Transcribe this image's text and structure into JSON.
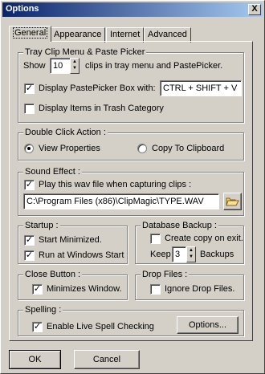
{
  "window": {
    "title": "Options",
    "close_symbol": "X"
  },
  "tabs": [
    {
      "label": "General",
      "active": true
    },
    {
      "label": "Appearance",
      "active": false
    },
    {
      "label": "Internet",
      "active": false
    },
    {
      "label": "Advanced",
      "active": false
    }
  ],
  "tray": {
    "group_label": "Tray Clip Menu & Paste Picker",
    "show_label": "Show",
    "show_count": "10",
    "show_suffix": "clips in tray menu and PastePicker.",
    "display_picker_label": "Display PastePicker Box",
    "display_picker_checked": true,
    "with_label": "with:",
    "hotkey": "CTRL + SHIFT + V",
    "display_trash_label": "Display Items in Trash Category",
    "display_trash_checked": false
  },
  "double_click": {
    "group_label": "Double Click Action :",
    "option_view": "View Properties",
    "option_copy": "Copy To Clipboard",
    "selected": "view"
  },
  "sound": {
    "group_label": "Sound Effect :",
    "play_label": "Play this wav file when capturing clips :",
    "play_checked": true,
    "path": "C:\\Program Files (x86)\\ClipMagic\\TYPE.WAV",
    "browse_icon": "folder-open-icon"
  },
  "startup": {
    "group_label": "Startup :",
    "minimized_label": "Start Minimized.",
    "minimized_checked": true,
    "run_label": "Run at Windows Start",
    "run_checked": true
  },
  "backup": {
    "group_label": "Database Backup :",
    "create_label": "Create copy on exit.",
    "create_checked": false,
    "keep_label": "Keep",
    "keep_value": "3",
    "backups_label": "Backups"
  },
  "close_button": {
    "group_label": "Close Button :",
    "minimizes_label": "Minimizes Window.",
    "minimizes_checked": true
  },
  "drop_files": {
    "group_label": "Drop Files :",
    "ignore_label": "Ignore Drop Files.",
    "ignore_checked": false
  },
  "spelling": {
    "group_label": "Spelling :",
    "live_label": "Enable Live Spell Checking",
    "live_checked": true,
    "options_button": "Options..."
  },
  "footer": {
    "ok": "OK",
    "cancel": "Cancel"
  }
}
